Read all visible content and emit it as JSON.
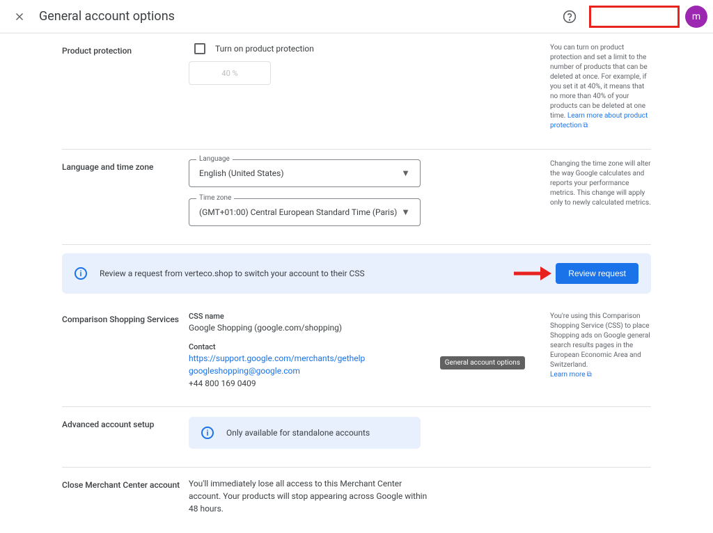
{
  "header": {
    "title": "General account options",
    "avatar_letter": "m"
  },
  "protection": {
    "label": "Product protection",
    "checkbox_label": "Turn on product protection",
    "percent": "40 %",
    "info": "You can turn on product protection and set a limit to the number of products that can be deleted at once. For example, if you set it at 40%, it means that no more than 40% of your products can be deleted at one time.",
    "learn_more": "Learn more about product protection"
  },
  "language": {
    "label": "Language and time zone",
    "lang_legend": "Language",
    "lang_value": "English (United States)",
    "tz_legend": "Time zone",
    "tz_value": "(GMT+01:00) Central European Standard Time (Paris)",
    "info": "Changing the time zone will alter the way Google calculates and reports your performance metrics. This change will apply only to newly calculated metrics."
  },
  "banner": {
    "text": "Review a request from verteco.shop to switch your account to their CSS",
    "button": "Review request"
  },
  "css": {
    "label": "Comparison Shopping Services",
    "name_label": "CSS name",
    "name_value": "Google Shopping (google.com/shopping)",
    "contact_label": "Contact",
    "contact_link": "https://support.google.com/merchants/gethelp",
    "contact_email": "googleshopping@google.com",
    "contact_phone": "+44 800 169 0409",
    "info": "You're using this Comparison Shopping Service (CSS) to place Shopping ads on Google general search results pages in the European Economic Area and Switzerland.",
    "learn_more": "Learn more",
    "tooltip": "General account options"
  },
  "advanced": {
    "label": "Advanced account setup",
    "info_text": "Only available for standalone accounts"
  },
  "close": {
    "label": "Close Merchant Center account",
    "text": "You'll immediately lose all access to this Merchant Center account. Your products will stop appearing across Google within 48 hours."
  }
}
